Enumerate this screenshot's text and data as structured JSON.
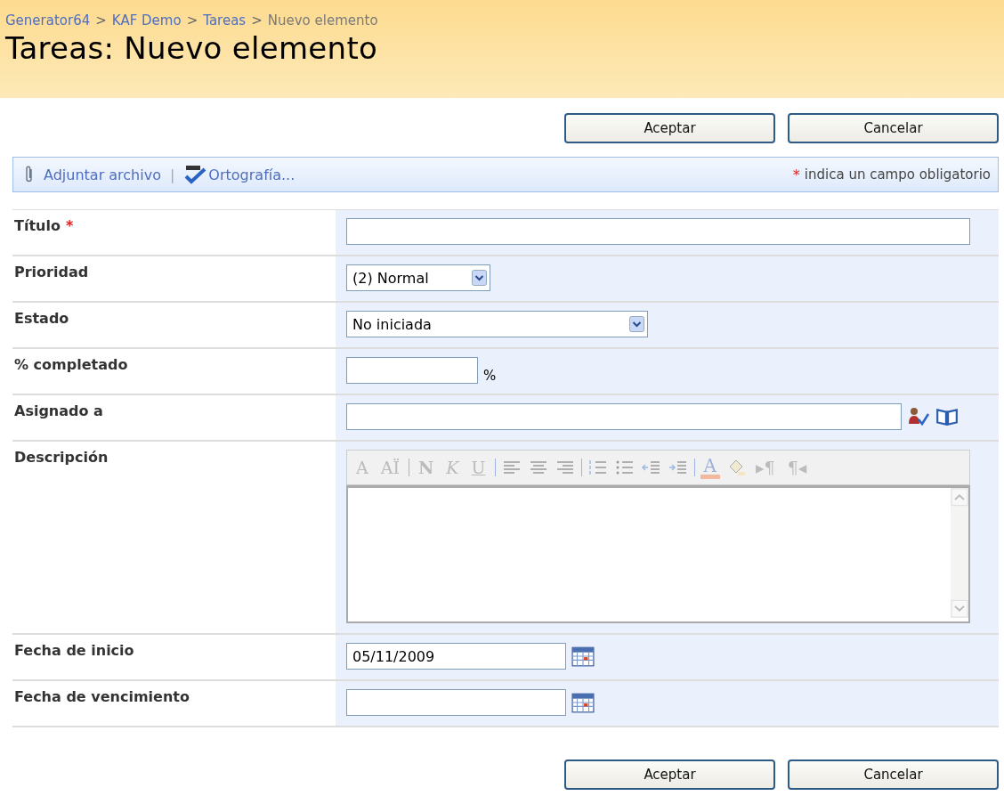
{
  "breadcrumb": [
    {
      "label": "Generator64",
      "link": true
    },
    {
      "label": "KAF Demo",
      "link": true
    },
    {
      "label": "Tareas",
      "link": true
    },
    {
      "label": "Nuevo elemento",
      "link": false
    }
  ],
  "breadcrumb_separator": ">",
  "page_title": "Tareas: Nuevo elemento",
  "top_buttons": [
    "Aceptar",
    "Cancelar"
  ],
  "toolbar": {
    "attach": "Adjuntar archivo",
    "separator": "|",
    "spelling": "Ortografía...",
    "required_mark": "*",
    "required_note": "indica un campo obligatorio"
  },
  "fields": [
    {
      "kind": "text",
      "label": "Título",
      "marker": "*"
    },
    {
      "kind": "select",
      "label": "Prioridad",
      "value": "(2) Normal",
      "wide": false
    },
    {
      "kind": "select",
      "label": "Estado",
      "value": "No iniciada",
      "wide": true
    },
    {
      "kind": "percent",
      "label": "% completado",
      "suffix": "%"
    },
    {
      "kind": "people",
      "label": "Asignado a"
    },
    {
      "kind": "richtext",
      "label": "Descripción",
      "toolbar_disabled": true,
      "tools": [
        {
          "kind": "glyph",
          "label": "A"
        },
        {
          "kind": "glyph",
          "label": "AÏ"
        },
        {
          "kind": "sep"
        },
        {
          "kind": "bold",
          "label": "N"
        },
        {
          "kind": "italic",
          "label": "K"
        },
        {
          "kind": "underline",
          "label": "U"
        },
        {
          "kind": "sep"
        },
        {
          "kind": "align-left"
        },
        {
          "kind": "align-center"
        },
        {
          "kind": "align-right"
        },
        {
          "kind": "sep"
        },
        {
          "kind": "numbered-list"
        },
        {
          "kind": "bullet-list"
        },
        {
          "kind": "outdent"
        },
        {
          "kind": "indent"
        },
        {
          "kind": "sep"
        },
        {
          "kind": "font-color",
          "label": "A"
        },
        {
          "kind": "highlight"
        },
        {
          "kind": "glyph",
          "label": "▸¶"
        },
        {
          "kind": "glyph",
          "label": "¶◂"
        }
      ]
    },
    {
      "kind": "date",
      "label": "Fecha de inicio",
      "value": "05/11/2009"
    },
    {
      "kind": "date",
      "label": "Fecha de vencimiento"
    }
  ],
  "bottom_buttons": [
    "Aceptar",
    "Cancelar"
  ]
}
